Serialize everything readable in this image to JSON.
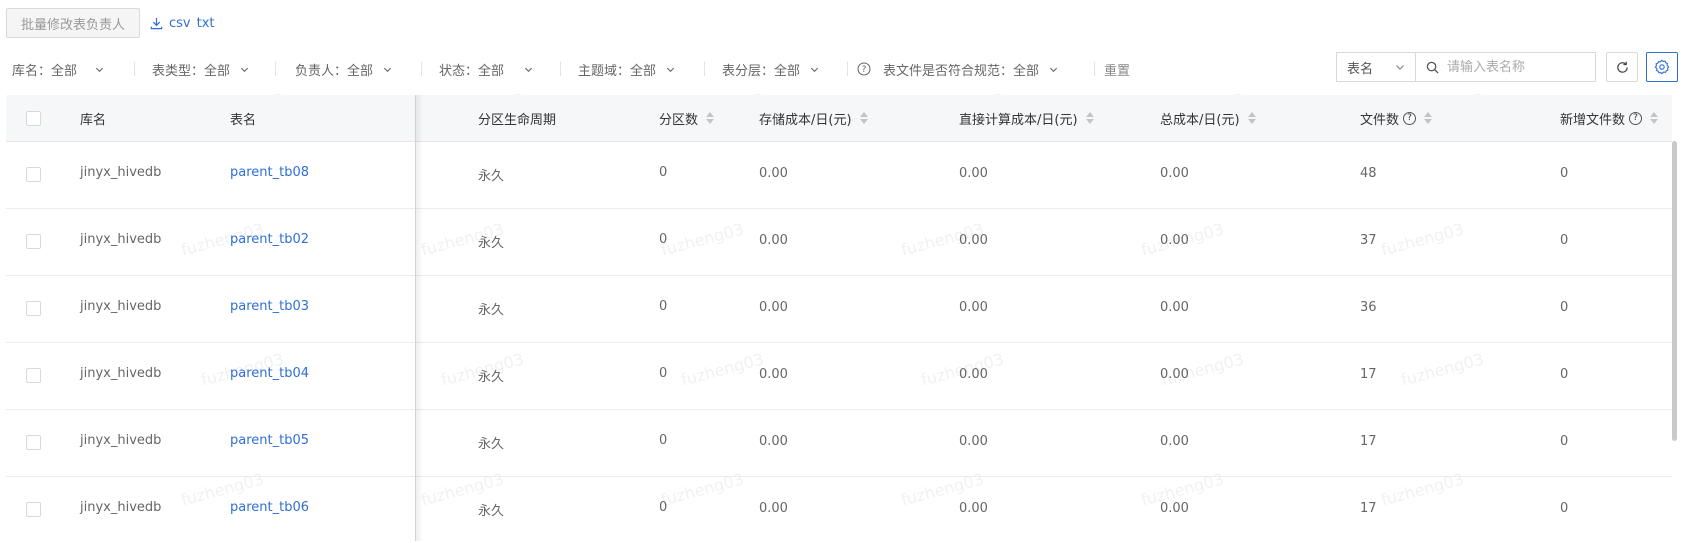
{
  "toolbar": {
    "batch_button": "批量修改表负责人",
    "export_csv": "csv",
    "export_txt": "txt",
    "export_icon": "download-icon"
  },
  "filters": [
    {
      "label": "库名：",
      "value": "全部"
    },
    {
      "label": "表类型：",
      "value": "全部"
    },
    {
      "label": "负责人：",
      "value": "全部"
    },
    {
      "label": "状态：",
      "value": "全部"
    },
    {
      "label": "主题域：",
      "value": "全部"
    },
    {
      "label": "表分层：",
      "value": "全部"
    },
    {
      "label": "表文件是否符合规范：",
      "value": "全部"
    }
  ],
  "reset_label": "重置",
  "search": {
    "type_value": "表名",
    "placeholder": "请输入表名称"
  },
  "table": {
    "columns": [
      "库名",
      "表名",
      "分区生命周期",
      "分区数",
      "存储成本/日(元)",
      "直接计算成本/日(元)",
      "总成本/日(元)",
      "文件数",
      "新增文件数"
    ],
    "rows": [
      {
        "db": "jinyx_hivedb",
        "table": "parent_tb08",
        "lifecycle": "永久",
        "partitions": "0",
        "storage": "0.00",
        "compute": "0.00",
        "total": "0.00",
        "files": "48",
        "new_files": "0"
      },
      {
        "db": "jinyx_hivedb",
        "table": "parent_tb02",
        "lifecycle": "永久",
        "partitions": "0",
        "storage": "0.00",
        "compute": "0.00",
        "total": "0.00",
        "files": "37",
        "new_files": "0"
      },
      {
        "db": "jinyx_hivedb",
        "table": "parent_tb03",
        "lifecycle": "永久",
        "partitions": "0",
        "storage": "0.00",
        "compute": "0.00",
        "total": "0.00",
        "files": "36",
        "new_files": "0"
      },
      {
        "db": "jinyx_hivedb",
        "table": "parent_tb04",
        "lifecycle": "永久",
        "partitions": "0",
        "storage": "0.00",
        "compute": "0.00",
        "total": "0.00",
        "files": "17",
        "new_files": "0"
      },
      {
        "db": "jinyx_hivedb",
        "table": "parent_tb05",
        "lifecycle": "永久",
        "partitions": "0",
        "storage": "0.00",
        "compute": "0.00",
        "total": "0.00",
        "files": "17",
        "new_files": "0"
      },
      {
        "db": "jinyx_hivedb",
        "table": "parent_tb06",
        "lifecycle": "永久",
        "partitions": "0",
        "storage": "0.00",
        "compute": "0.00",
        "total": "0.00",
        "files": "17",
        "new_files": "0"
      }
    ]
  },
  "watermark": "fuzheng03",
  "colors": {
    "link": "#2f6fd6",
    "header_bg": "#f6f7f9"
  }
}
